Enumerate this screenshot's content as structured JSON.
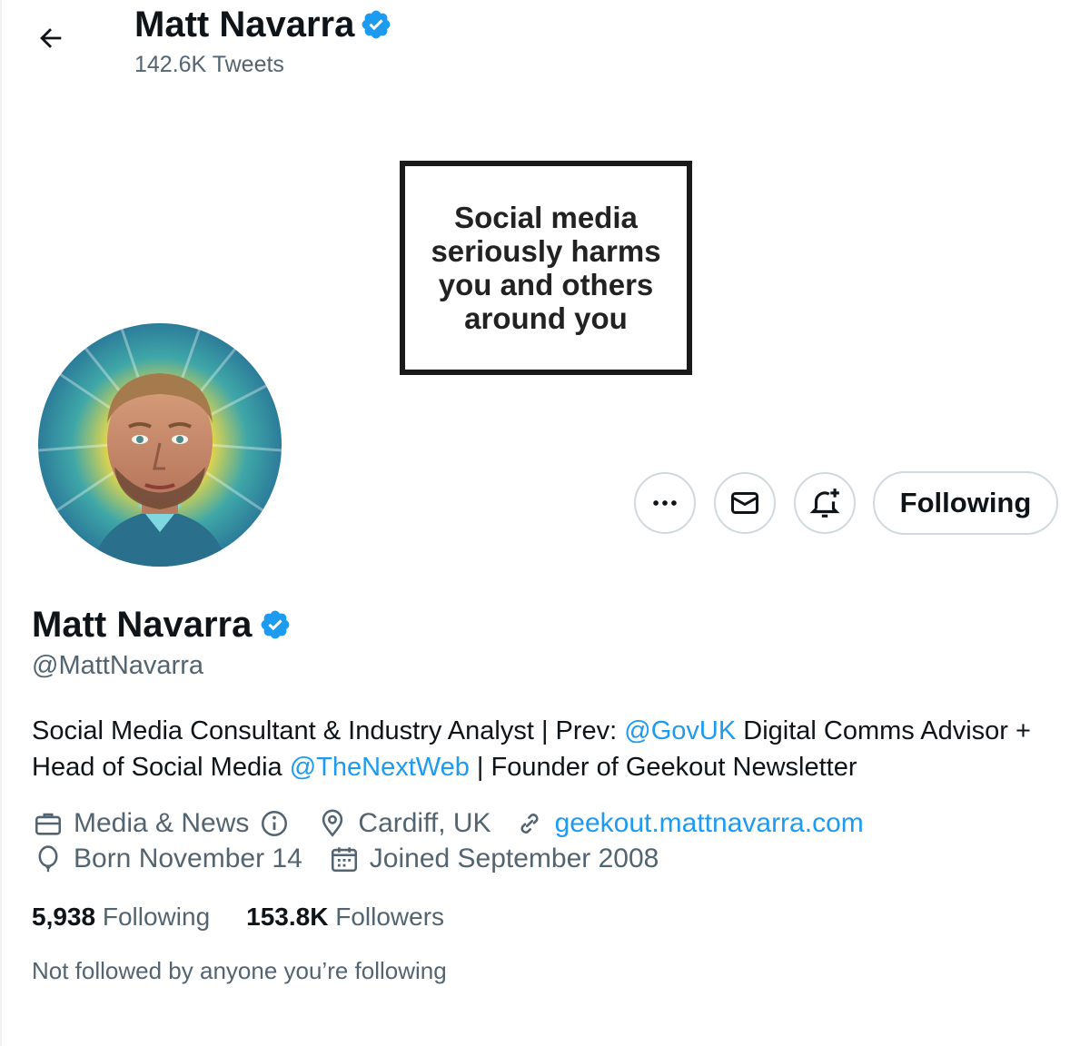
{
  "header": {
    "name": "Matt Navarra",
    "tweet_count": "142.6K Tweets"
  },
  "banner": {
    "line1": "Social media",
    "line2": "seriously harms",
    "line3": "you and others",
    "line4": "around you"
  },
  "actions": {
    "more_icon": "more-icon",
    "message_icon": "mail-icon",
    "notify_icon": "bell-plus-icon",
    "following_label": "Following"
  },
  "profile": {
    "name": "Matt Navarra",
    "handle": "@MattNavarra",
    "bio": {
      "part1": "Social Media Consultant & Industry Analyst | Prev: ",
      "mention1": "@GovUK",
      "part2": " Digital Comms Advisor + Head of Social Media ",
      "mention2": "@TheNextWeb",
      "part3": " | Founder of Geekout Newsletter"
    },
    "category": "Media & News",
    "location": "Cardiff, UK",
    "website": "geekout.mattnavarra.com",
    "birthday": "Born November 14",
    "joined": "Joined September 2008"
  },
  "stats": {
    "following_count": "5,938",
    "following_label": "Following",
    "followers_count": "153.8K",
    "followers_label": "Followers"
  },
  "social_context": "Not followed by anyone you’re following",
  "colors": {
    "accent": "#1d9bf0",
    "text": "#0f1419",
    "muted": "#536471",
    "border": "#cfd9de"
  }
}
